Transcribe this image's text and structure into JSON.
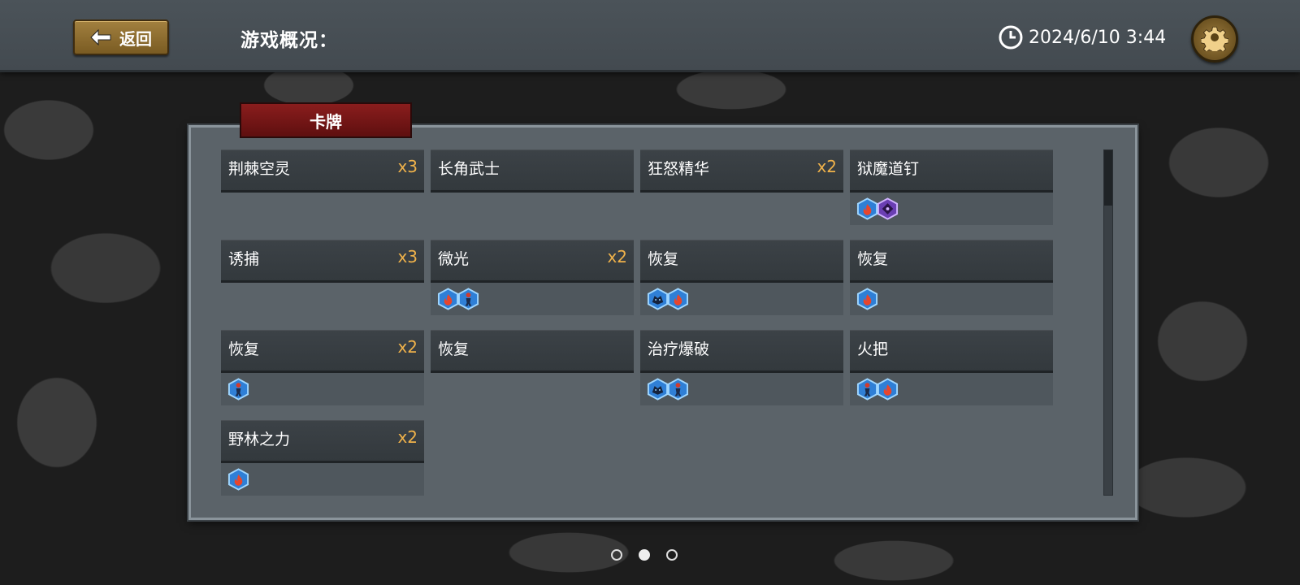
{
  "header": {
    "back_label": "返回",
    "title": "游戏概况：",
    "datetime": "2024/6/10 3:44"
  },
  "panel": {
    "tab_label": "卡牌"
  },
  "cards": [
    {
      "name": "荆棘空灵",
      "count": "x3",
      "icons": []
    },
    {
      "name": "长角武士",
      "count": "",
      "icons": []
    },
    {
      "name": "狂怒精华",
      "count": "x2",
      "icons": []
    },
    {
      "name": "狱魔道钉",
      "count": "",
      "icons": [
        "fire-gem-icon",
        "purple-rune-icon"
      ]
    },
    {
      "name": "诱捕",
      "count": "x3",
      "icons": []
    },
    {
      "name": "微光",
      "count": "x2",
      "icons": [
        "fire-gem-icon",
        "figure-gem-icon"
      ]
    },
    {
      "name": "恢复",
      "count": "",
      "icons": [
        "beast-gem-icon",
        "fire-gem-icon"
      ]
    },
    {
      "name": "恢复",
      "count": "",
      "icons": [
        "fire-gem-icon"
      ]
    },
    {
      "name": "恢复",
      "count": "x2",
      "icons": [
        "figure-gem-icon"
      ]
    },
    {
      "name": "恢复",
      "count": "",
      "icons": []
    },
    {
      "name": "治疗爆破",
      "count": "",
      "icons": [
        "beast-gem-icon",
        "figure-gem-icon"
      ]
    },
    {
      "name": "火把",
      "count": "",
      "icons": [
        "figure-gem-icon",
        "fire-gem-icon"
      ]
    },
    {
      "name": "野林之力",
      "count": "x2",
      "icons": [
        "fire-gem-icon"
      ]
    }
  ],
  "pagination": {
    "total": 3,
    "current": 2
  },
  "colors": {
    "count": "#f0b24a",
    "tab": "#7a1616",
    "panel": "#5b6369"
  }
}
